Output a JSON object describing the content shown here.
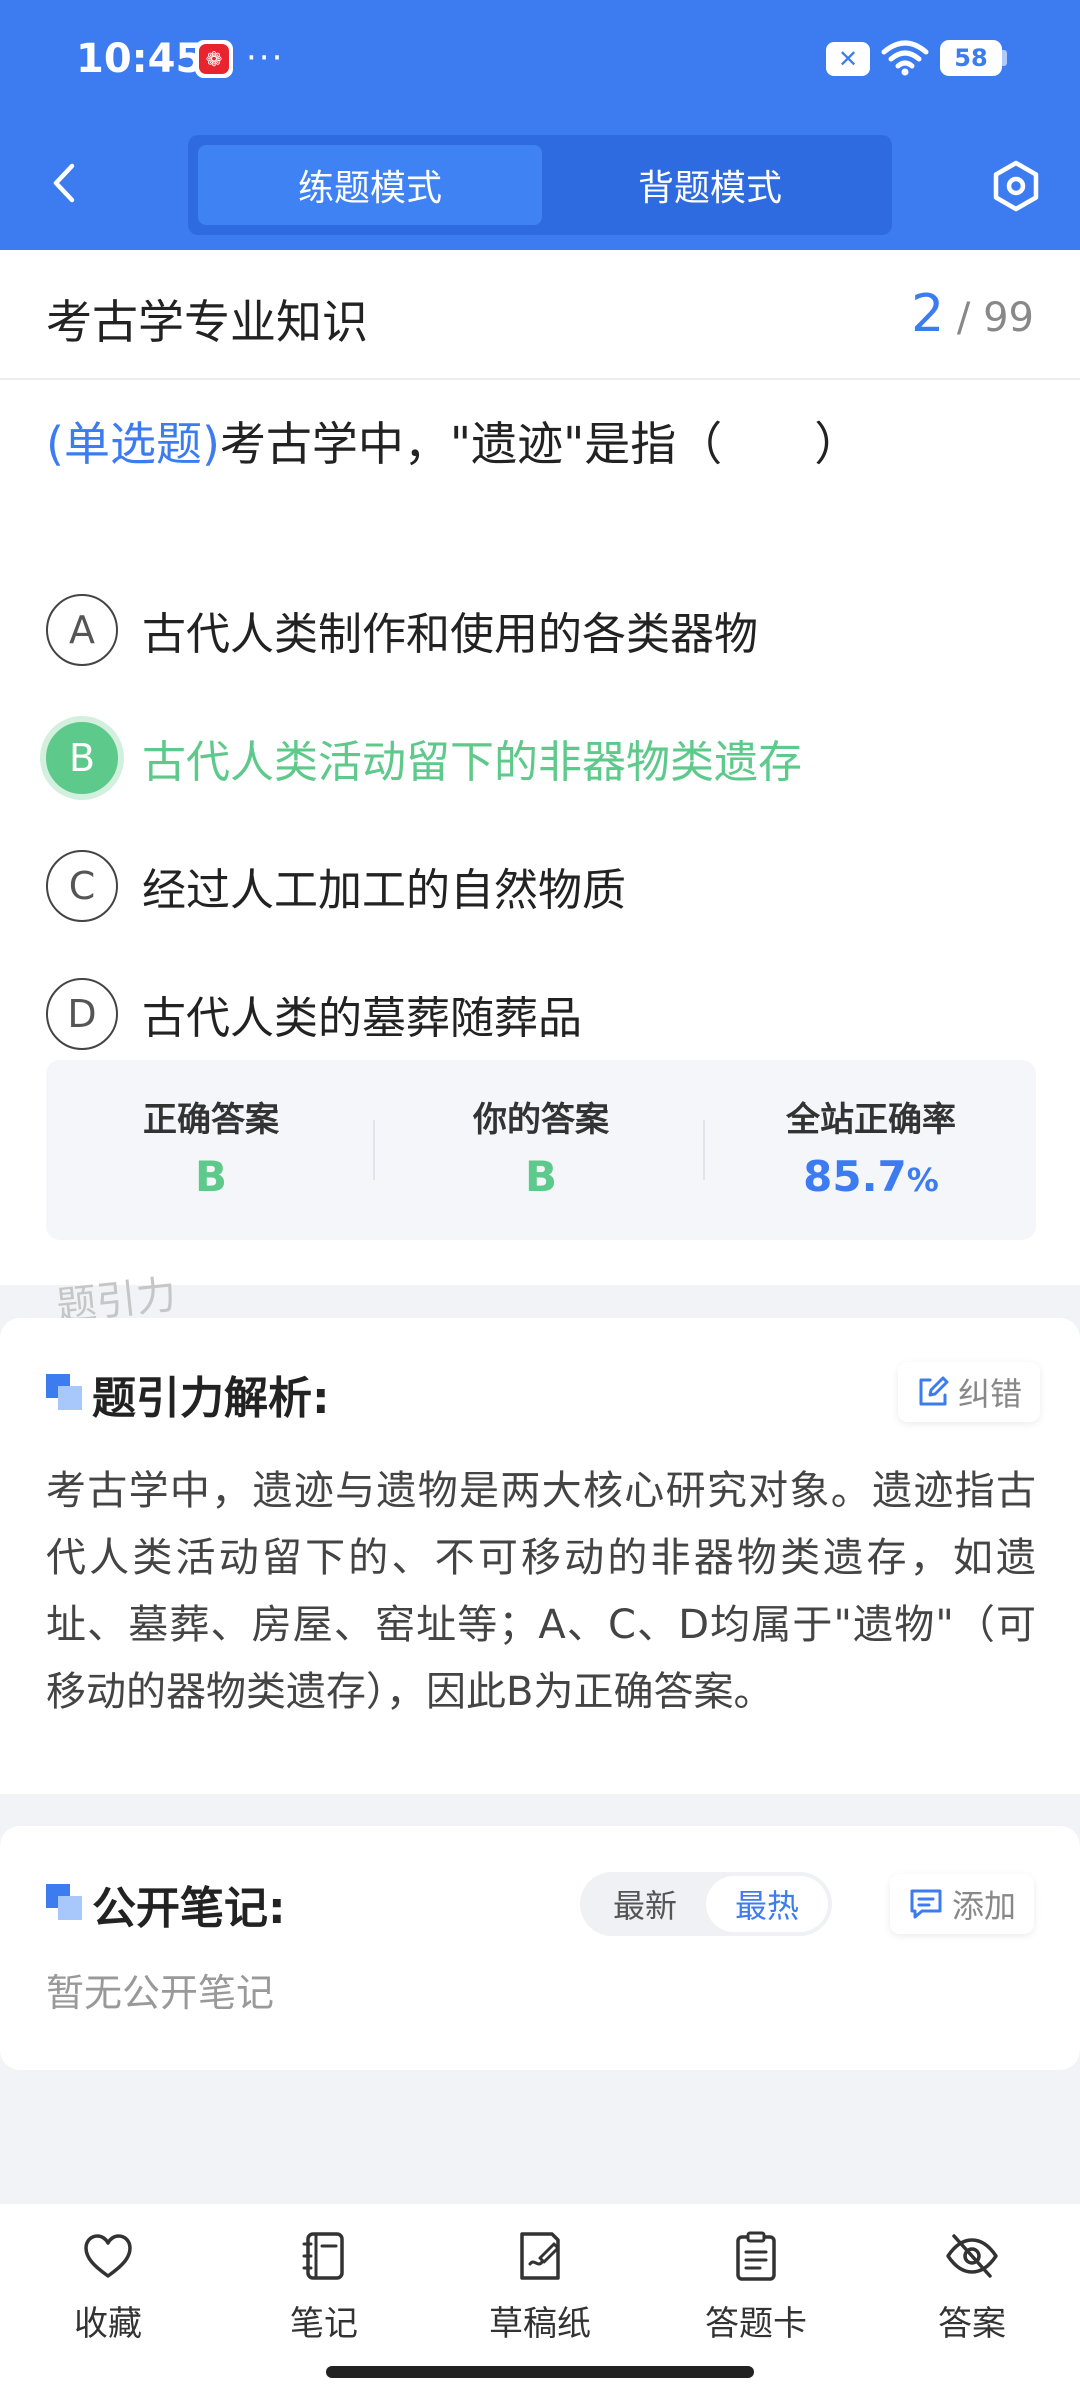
{
  "status_bar": {
    "time": "10:45",
    "dots": "···",
    "battery": "58"
  },
  "header": {
    "modes": [
      "练题模式",
      "背题模式"
    ],
    "active_mode": "练题模式"
  },
  "subject": {
    "title": "考古学专业知识",
    "current": "2",
    "total": "/ 99"
  },
  "question": {
    "type": "(单选题)",
    "text": "考古学中，\"遗迹\"是指（　　）",
    "options": [
      {
        "letter": "A",
        "text": "古代人类制作和使用的各类器物"
      },
      {
        "letter": "B",
        "text": "古代人类活动留下的非器物类遗存"
      },
      {
        "letter": "C",
        "text": "经过人工加工的自然物质"
      },
      {
        "letter": "D",
        "text": "古代人类的墓葬随葬品"
      }
    ],
    "selected": "B"
  },
  "stats": {
    "correct_label": "正确答案",
    "correct_value": "B",
    "yours_label": "你的答案",
    "yours_value": "B",
    "rate_label": "全站正确率",
    "rate_value": "85.7",
    "rate_unit": "%"
  },
  "watermark": "题引力",
  "analysis": {
    "title": "题引力解析:",
    "report_label": "纠错",
    "text": "考古学中，遗迹与遗物是两大核心研究对象。遗迹指古代人类活动留下的、不可移动的非器物类遗存，如遗址、墓葬、房屋、窑址等；A、C、D均属于\"遗物\"（可移动的器物类遗存），因此B为正确答案。"
  },
  "notes": {
    "title": "公开笔记:",
    "sort_latest": "最新",
    "sort_hot": "最热",
    "add_label": "添加",
    "empty": "暂无公开笔记"
  },
  "bottom_nav": [
    "收藏",
    "笔记",
    "草稿纸",
    "答题卡",
    "答案"
  ],
  "colors": {
    "primary": "#3d7cf0",
    "correct": "#5dc98a"
  }
}
